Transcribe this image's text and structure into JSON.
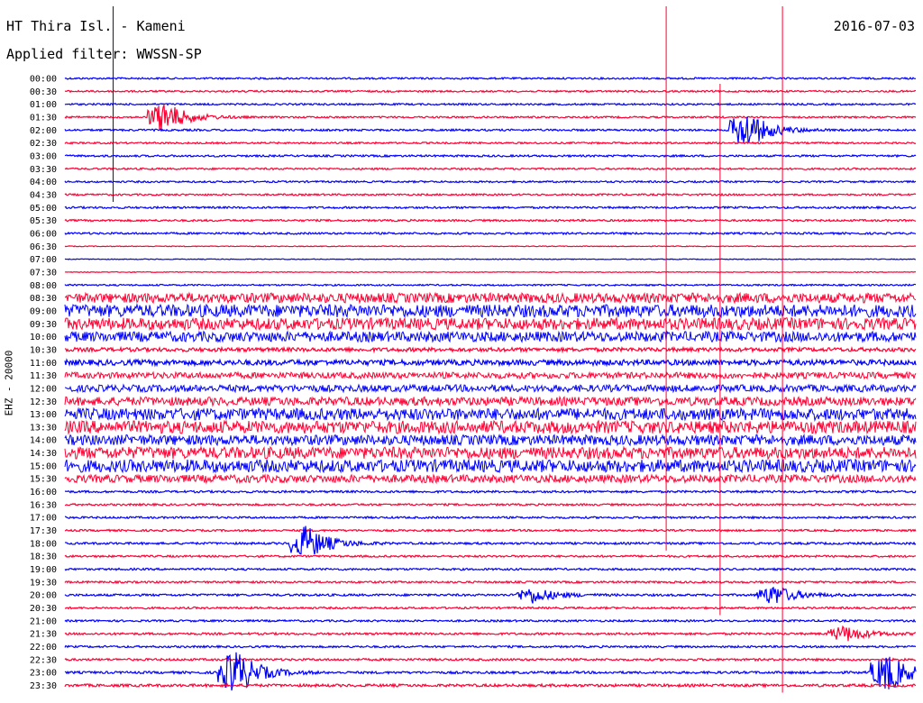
{
  "header": {
    "station": "HT Thira Isl. - Kameni",
    "date": "2016-07-03",
    "filter": "Applied filter: WWSSN-SP"
  },
  "channel_label": "EHZ - 20000",
  "colors": {
    "odd_trace": "#0000ff",
    "even_trace": "#ff0033",
    "background": "#ffffff",
    "text": "#000000"
  },
  "chart_data": {
    "type": "line",
    "title": "HT Thira Isl. - Kameni",
    "subtitle": "Applied filter: WWSSN-SP",
    "date": "2016-07-03",
    "ylabel": "EHZ - 20000",
    "row_labels": [
      "00:00",
      "00:30",
      "01:00",
      "01:30",
      "02:00",
      "02:30",
      "03:00",
      "03:30",
      "04:00",
      "04:30",
      "05:00",
      "05:30",
      "06:00",
      "06:30",
      "07:00",
      "07:30",
      "08:00",
      "08:30",
      "09:00",
      "09:30",
      "10:00",
      "10:30",
      "11:00",
      "11:30",
      "12:00",
      "12:30",
      "13:00",
      "13:30",
      "14:00",
      "14:30",
      "15:00",
      "15:30",
      "16:00",
      "16:30",
      "17:00",
      "17:30",
      "18:00",
      "18:30",
      "19:00",
      "19:30",
      "20:00",
      "20:30",
      "21:00",
      "21:30",
      "22:00",
      "22:30",
      "23:00",
      "23:30"
    ],
    "row_duration_minutes": 30,
    "row_colors_cycle": [
      "#0000ff",
      "#ff0033"
    ],
    "noise_level_per_row": [
      0.45,
      0.45,
      0.45,
      0.45,
      0.5,
      0.45,
      0.5,
      0.45,
      0.45,
      0.45,
      0.5,
      0.5,
      0.5,
      0.2,
      0.2,
      0.2,
      0.4,
      2.5,
      3.2,
      3.0,
      2.6,
      1.0,
      1.4,
      1.6,
      1.8,
      2.2,
      3.0,
      3.2,
      2.6,
      3.0,
      3.2,
      2.0,
      0.55,
      0.5,
      0.5,
      0.5,
      0.55,
      0.5,
      0.5,
      0.5,
      0.55,
      0.5,
      0.5,
      0.55,
      0.5,
      0.55,
      0.6,
      0.7
    ],
    "events": [
      {
        "row": "01:30",
        "time_minutes": 3.5,
        "amplitude": 8
      },
      {
        "row": "02:00",
        "time_minutes": 24.0,
        "amplitude": 10
      },
      {
        "row": "18:00",
        "time_minutes": 8.5,
        "amplitude": 9
      },
      {
        "row": "20:00",
        "time_minutes": 16.5,
        "amplitude": 4
      },
      {
        "row": "20:00",
        "time_minutes": 25.0,
        "amplitude": 5
      },
      {
        "row": "23:00",
        "time_minutes": 6.0,
        "amplitude": 12
      },
      {
        "row": "23:00",
        "time_minutes": 29.0,
        "amplitude": 10
      },
      {
        "row": "21:30",
        "time_minutes": 27.5,
        "amplitude": 4
      }
    ],
    "vertical_markers": [
      {
        "color": "#0000ff",
        "time_minutes": 1.7,
        "row_start": "00:00",
        "row_end": "04:30"
      },
      {
        "color": "#ff0033",
        "time_minutes": 21.2,
        "row_start": "00:00",
        "row_end": "18:00"
      },
      {
        "color": "#ff0033",
        "time_minutes": 25.3,
        "row_start": "00:00",
        "row_end": "23:30"
      },
      {
        "color": "#ff0033",
        "time_minutes": 23.1,
        "row_start": "03:00",
        "row_end": "20:30"
      }
    ],
    "grid": false
  }
}
